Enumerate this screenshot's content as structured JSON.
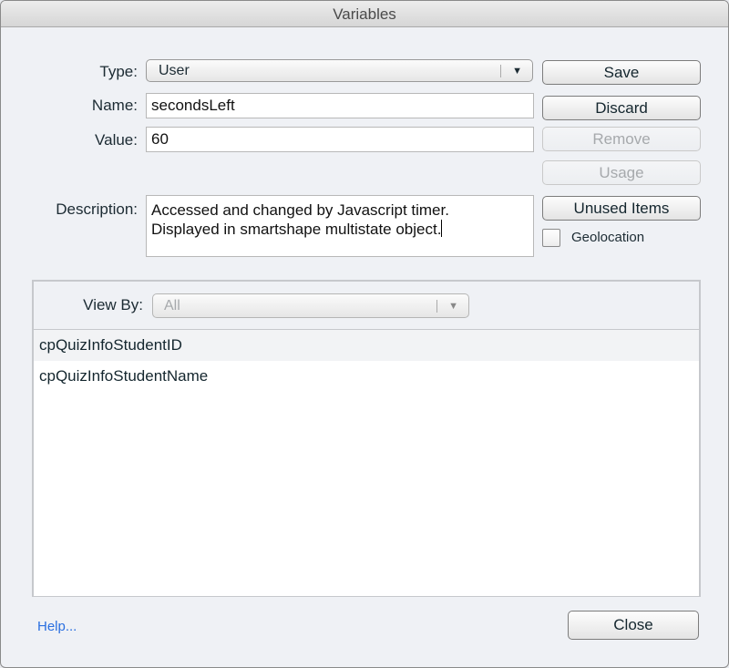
{
  "window": {
    "title": "Variables"
  },
  "form": {
    "type_label": "Type:",
    "type_value": "User",
    "name_label": "Name:",
    "name_value": "secondsLeft",
    "value_label": "Value:",
    "value_value": "60",
    "description_label": "Description:",
    "description_lines": [
      "Accessed and changed by Javascript timer.",
      "Displayed in smartshape multistate object."
    ]
  },
  "actions": {
    "save": "Save",
    "discard": "Discard",
    "remove": "Remove",
    "usage": "Usage",
    "unused_items": "Unused Items",
    "geolocation_label": "Geolocation",
    "geolocation_checked": false
  },
  "panel": {
    "view_by_label": "View By:",
    "view_by_value": "All",
    "items": [
      "cpQuizInfoStudentID",
      "cpQuizInfoStudentName"
    ]
  },
  "footer": {
    "help_link": "Help...",
    "close": "Close"
  },
  "colors": {
    "link": "#2a6fe0",
    "disabled_text": "#a6a9ac"
  }
}
